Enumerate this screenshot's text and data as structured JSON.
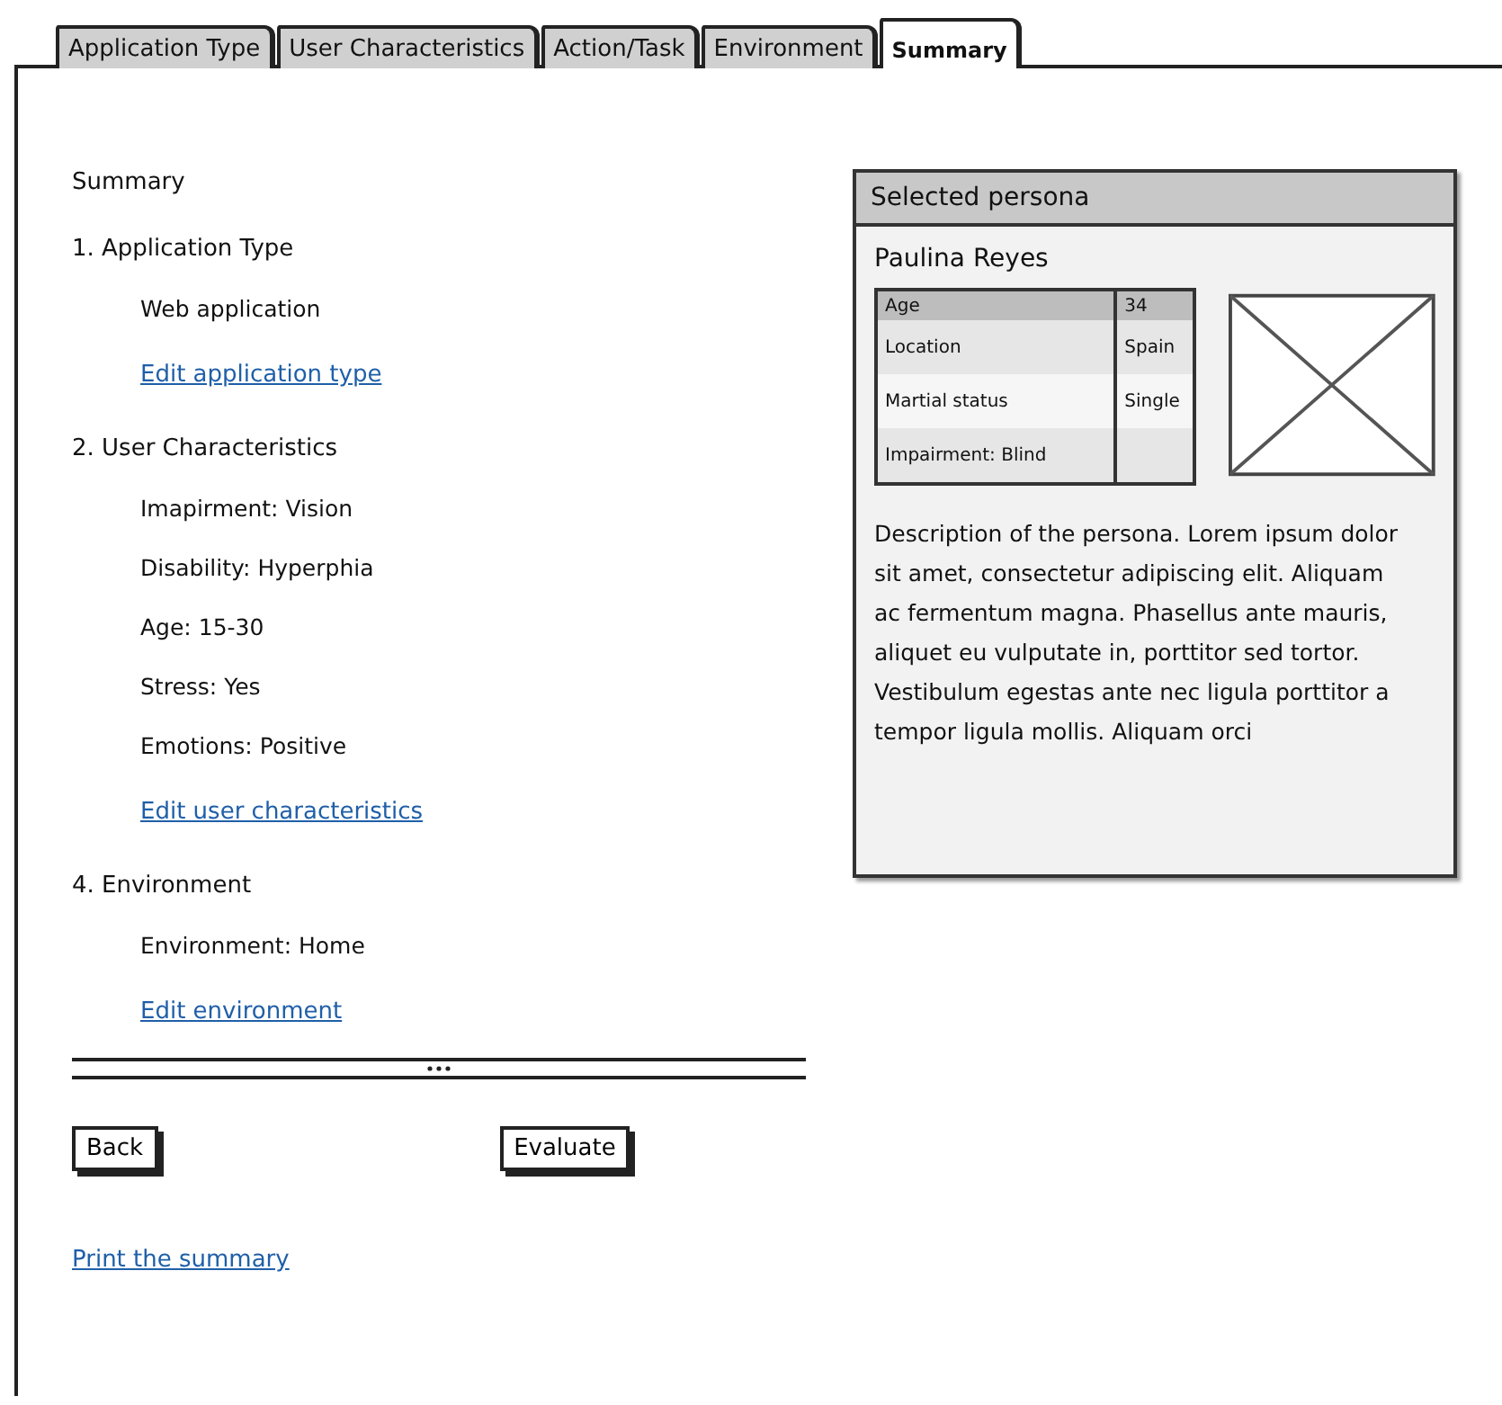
{
  "tabs": [
    {
      "label": "Application Type",
      "selected": false
    },
    {
      "label": "User Characteristics",
      "selected": false
    },
    {
      "label": "Action/Task",
      "selected": false
    },
    {
      "label": "Environment",
      "selected": false
    },
    {
      "label": "Summary",
      "selected": true
    }
  ],
  "summary": {
    "title": "Summary",
    "sections": [
      {
        "heading": "1. Application Type",
        "items": [
          "Web application"
        ],
        "link": "Edit application type"
      },
      {
        "heading": "2. User Characteristics",
        "items": [
          "Imapirment: Vision",
          "Disability: Hyperphia",
          "Age: 15-30",
          "Stress: Yes",
          "Emotions: Positive"
        ],
        "link": "Edit user characteristics"
      },
      {
        "heading": "4. Environment",
        "items": [
          "Environment: Home"
        ],
        "link": "Edit environment"
      }
    ]
  },
  "buttons": [
    "Back",
    "Evaluate"
  ],
  "print_link": "Print the summary",
  "persona": {
    "title": "Selected persona",
    "name": "Paulina Reyes",
    "rows": [
      {
        "label": "Age",
        "value": "34",
        "selected": true
      },
      {
        "label": "Location",
        "value": "Spain",
        "selected": false
      },
      {
        "label": "Martial status",
        "value": "Single",
        "selected": false
      },
      {
        "label": "Impairment: Blind",
        "value": "",
        "selected": false
      }
    ],
    "description": "Description of the persona. Lorem ipsum dolor sit amet, consectetur adipiscing elit. Aliquam ac fermentum magna. Phasellus ante mauris, aliquet eu vulputate in, porttitor sed tortor. Vestibulum egestas ante nec ligula porttitor a tempor ligula mollis. Aliquam orci"
  }
}
